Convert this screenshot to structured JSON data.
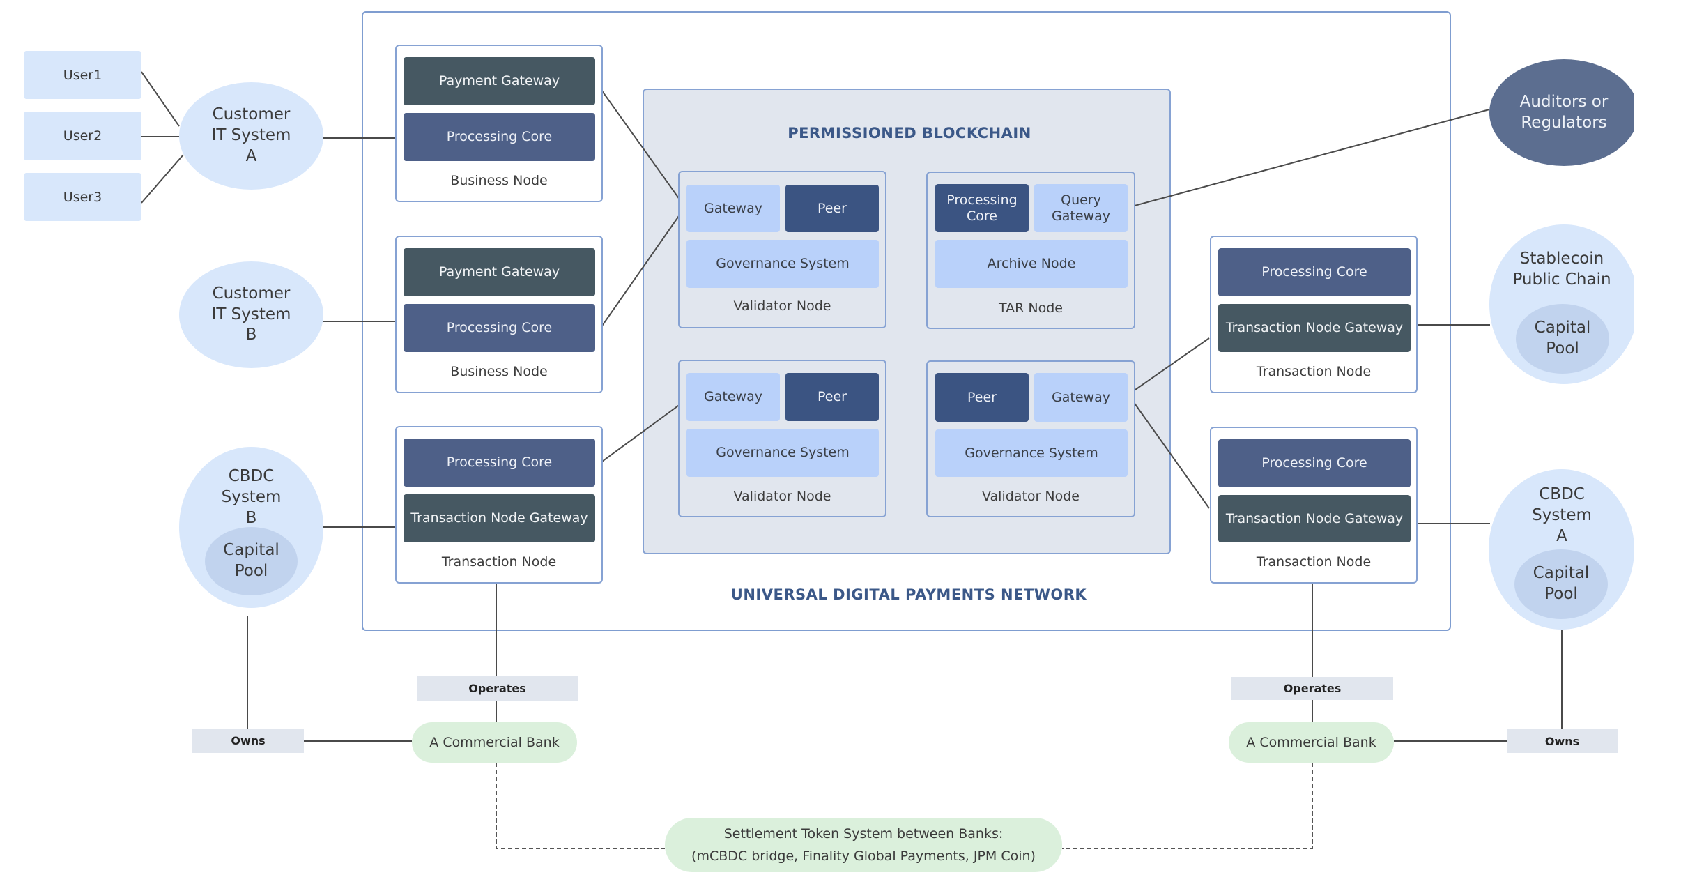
{
  "diagram": {
    "network_title": "UNIVERSAL DIGITAL PAYMENTS NETWORK",
    "blockchain_title": "PERMISSIONED BLOCKCHAIN",
    "users": [
      "User1",
      "User2",
      "User3"
    ],
    "customer_systems": {
      "a": "Customer IT System A",
      "b": "Customer IT System B"
    },
    "cbdc_b": {
      "label": "CBDC System B",
      "pool": "Capital Pool"
    },
    "cbdc_a": {
      "label": "CBDC System A",
      "pool": "Capital Pool"
    },
    "stablecoin": {
      "label": "Stablecoin Public Chain",
      "pool": "Capital Pool"
    },
    "auditors": "Auditors or Regulators",
    "business_nodes": [
      {
        "gateway": "Payment Gateway",
        "core": "Processing Core",
        "label": "Business Node"
      },
      {
        "gateway": "Payment Gateway",
        "core": "Processing Core",
        "label": "Business Node"
      }
    ],
    "transaction_nodes": {
      "left": {
        "core": "Processing Core",
        "gateway": "Transaction Node Gateway",
        "label": "Transaction Node"
      },
      "right_top": {
        "core": "Processing Core",
        "gateway": "Transaction Node Gateway",
        "label": "Transaction Node"
      },
      "right_bottom": {
        "core": "Processing Core",
        "gateway": "Transaction Node Gateway",
        "label": "Transaction Node"
      }
    },
    "validator_nodes": [
      {
        "gateway": "Gateway",
        "peer": "Peer",
        "governance": "Governance System",
        "label": "Validator Node"
      },
      {
        "gateway": "Gateway",
        "peer": "Peer",
        "governance": "Governance System",
        "label": "Validator Node"
      },
      {
        "peer": "Peer",
        "gateway": "Gateway",
        "governance": "Governance System",
        "label": "Validator Node"
      }
    ],
    "tar_node": {
      "core": "Processing Core",
      "query": "Query Gateway",
      "archive": "Archive Node",
      "label": "TAR Node"
    },
    "relations": {
      "operates": "Operates",
      "owns": "Owns"
    },
    "banks": [
      "A Commercial Bank",
      "A Commercial Bank"
    ],
    "settlement": {
      "line1": "Settlement Token System between Banks:",
      "line2": "(mCBDC bridge, Finality Global Payments, JPM Coin)"
    },
    "colors": {
      "border": "#86a2d3",
      "dark_slate": "#465862",
      "slate_blue": "#4e6088",
      "navy": "#3b5482",
      "light_blue": "#b9d1fa",
      "ellipse": "#d8e7fb",
      "auditors": "#5c6e90",
      "bank_green": "#dbf0dc",
      "title_blue": "#3b5888"
    }
  }
}
